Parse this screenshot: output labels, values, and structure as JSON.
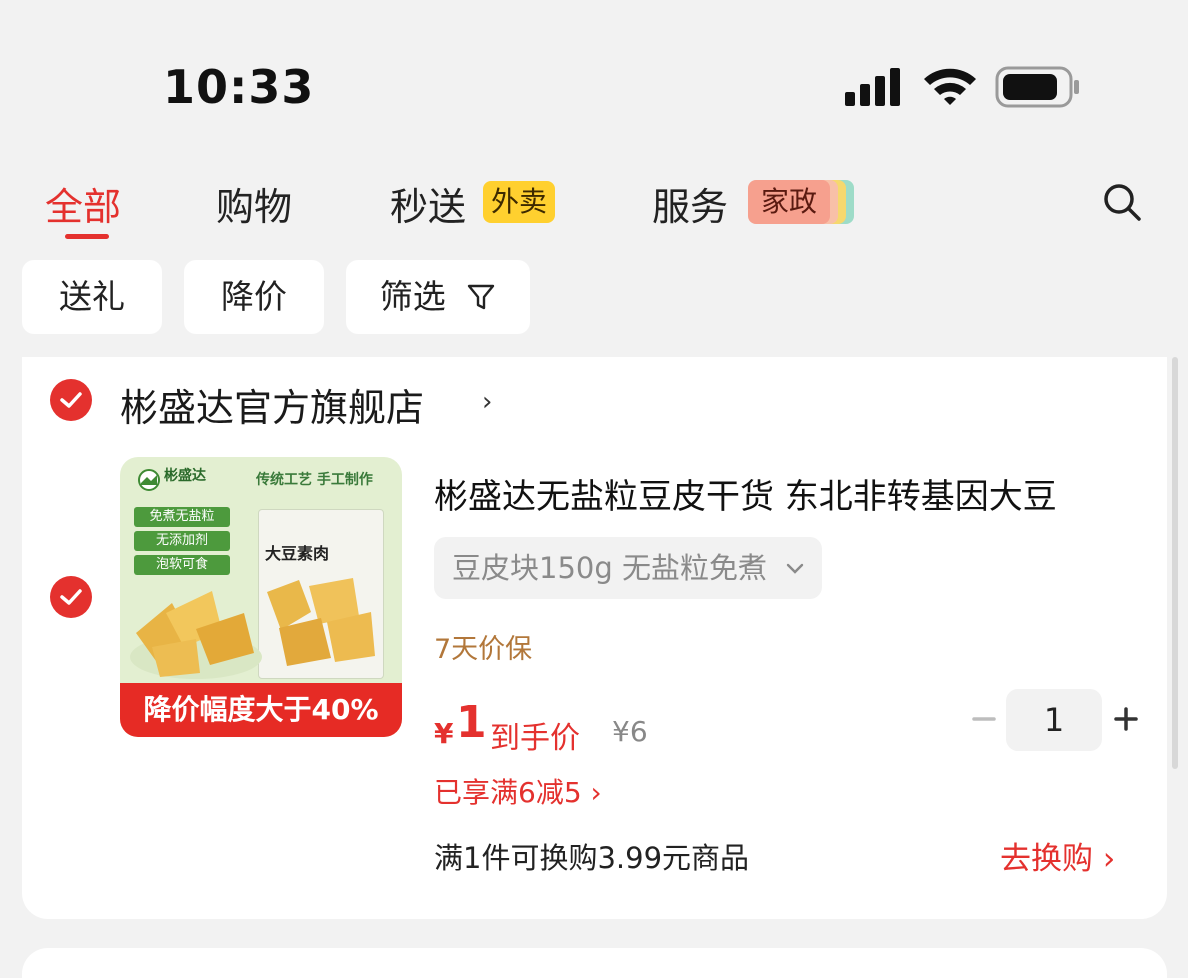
{
  "status_bar": {
    "time": "10:33"
  },
  "tabs": [
    {
      "label": "全部",
      "active": true
    },
    {
      "label": "购物"
    },
    {
      "label": "秒送",
      "badge": "外卖"
    },
    {
      "label": "服务",
      "badge": "家政"
    }
  ],
  "filters": [
    {
      "label": "送礼"
    },
    {
      "label": "降价"
    },
    {
      "label": "筛选",
      "icon": "funnel-icon"
    }
  ],
  "shop": {
    "name": "彬盛达官方旗舰店",
    "checked": true
  },
  "product": {
    "checked": true,
    "title": "彬盛达无盐粒豆皮干货 东北非转基因大豆",
    "sku": "豆皮块150g 无盐粒免煮",
    "guarantee": "7天价保",
    "price_currency": "¥",
    "price": "1",
    "price_label": "到手价",
    "original_price": "¥6",
    "quantity": "1",
    "promo": "已享满6减5 ›",
    "exchange_text": "满1件可换购3.99元商品",
    "exchange_link": "去换购 ›",
    "thumbnail": {
      "brand": "彬盛达",
      "slogan": "传统工艺 手工制作",
      "features": [
        "免煮无盐粒",
        "无添加剂",
        "泡软可食"
      ],
      "package_title": "大豆素肉",
      "sale_banner": "降价幅度大于40%"
    }
  },
  "colors": {
    "accent": "#e4312e",
    "page_bg": "#f2f2f2",
    "waimai_badge": "#ffd02f",
    "jiazheng_badge": "#f6a08e"
  }
}
